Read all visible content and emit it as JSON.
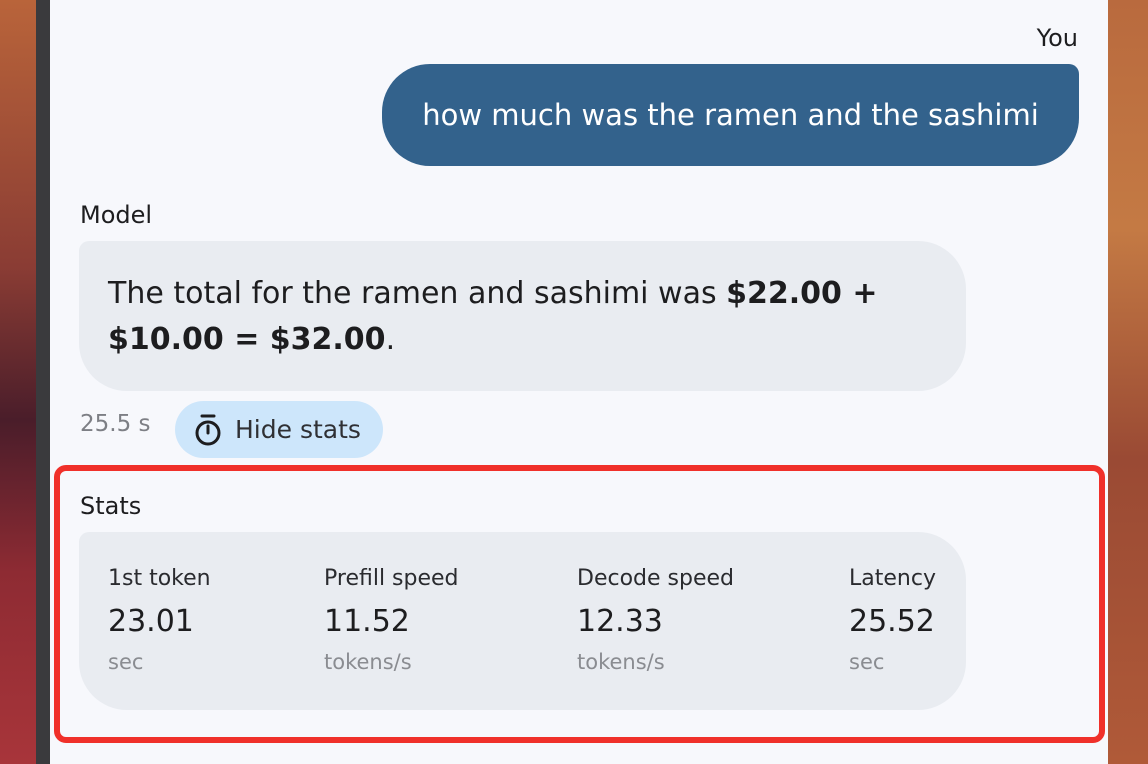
{
  "chat": {
    "user": {
      "sender": "You",
      "message": "how much was the ramen and the sashimi"
    },
    "model": {
      "sender": "Model",
      "text_before": "The total for the ramen and sashimi was ",
      "text_bold": "$22.00 + $10.00 = $32.00",
      "text_after": "."
    },
    "elapsed": "25.5 s",
    "stats_toggle": {
      "label": "Hide stats",
      "icon": "stopwatch-icon"
    }
  },
  "stats": {
    "title": "Stats",
    "items": [
      {
        "label": "1st token",
        "value": "23.01",
        "unit": "sec"
      },
      {
        "label": "Prefill speed",
        "value": "11.52",
        "unit": "tokens/s"
      },
      {
        "label": "Decode speed",
        "value": "12.33",
        "unit": "tokens/s"
      },
      {
        "label": "Latency",
        "value": "25.52",
        "unit": "sec"
      }
    ]
  },
  "colors": {
    "user_bubble": "#33628c",
    "model_bubble": "#e9ecf1",
    "toggle_chip": "#cde6fb",
    "highlight": "#f0302a"
  }
}
